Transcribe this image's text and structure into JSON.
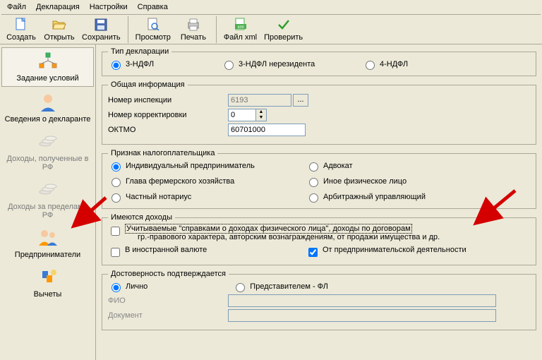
{
  "menu": {
    "file": "Файл",
    "decl": "Декларация",
    "settings": "Настройки",
    "help": "Справка"
  },
  "toolbar": {
    "create": "Создать",
    "open": "Открыть",
    "save": "Сохранить",
    "preview": "Просмотр",
    "print": "Печать",
    "xml": "Файл xml",
    "check": "Проверить"
  },
  "sidebar": {
    "conditions": "Задание условий",
    "declarant": "Сведения о декларанте",
    "income_rf": "Доходы, полученные в РФ",
    "income_abroad": "Доходы за пределами РФ",
    "entr": "Предприниматели",
    "deductions": "Вычеты"
  },
  "decl_type": {
    "legend": "Тип декларации",
    "opt1": "3-НДФЛ",
    "opt2": "3-НДФЛ нерезидента",
    "opt3": "4-НДФЛ"
  },
  "general": {
    "legend": "Общая информация",
    "insp_label": "Номер инспекции",
    "insp_value": "6193",
    "corr_label": "Номер корректировки",
    "corr_value": "0",
    "oktmo_label": "ОКТМО",
    "oktmo_value": "60701000"
  },
  "taxpayer": {
    "legend": "Признак налогоплательщика",
    "opt1": "Индивидуальный предприниматель",
    "opt2": "Глава фермерского хозяйства",
    "opt3": "Частный нотариус",
    "opt4": "Адвокат",
    "opt5": "Иное физическое лицо",
    "opt6": "Арбитражный управляющий"
  },
  "income": {
    "legend": "Имеются доходы",
    "chk1a": "Учитываемые \"справками о доходах физического лица\", доходы по договорам",
    "chk1b": "гр.-правового характера, авторским вознаграждениям, от продажи имущества и др.",
    "chk2": "В иностранной валюте",
    "chk3": "От предпринимательской деятельности"
  },
  "confirm": {
    "legend": "Достоверность подтверждается",
    "opt1": "Лично",
    "opt2": "Представителем - ФЛ",
    "fio": "ФИО",
    "doc": "Документ"
  }
}
